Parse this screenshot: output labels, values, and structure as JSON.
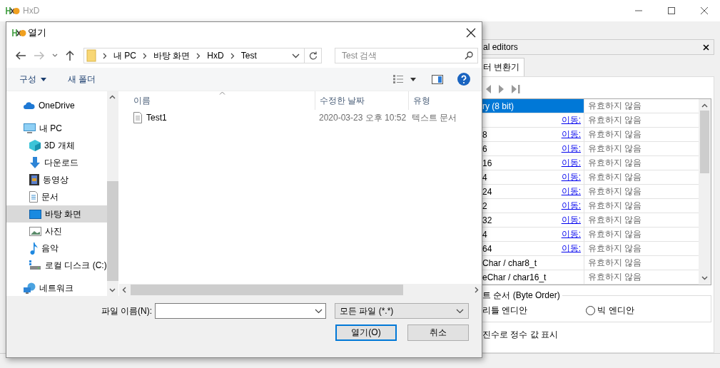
{
  "window": {
    "title": "HxD"
  },
  "dialog": {
    "title": "열기",
    "path": [
      "내 PC",
      "바탕 화면",
      "HxD",
      "Test"
    ],
    "search": {
      "placeholder": "Test 검색"
    },
    "commands": [
      {
        "label": "구성",
        "menu": true
      },
      {
        "label": "새 폴더",
        "menu": false
      }
    ],
    "nav": [
      {
        "label": "OneDrive",
        "kind": "cloud",
        "selected": false
      },
      {
        "label": "내 PC",
        "kind": "computer",
        "selected": false,
        "children": [
          {
            "label": "3D 개체",
            "kind": "cube",
            "selected": false
          },
          {
            "label": "다운로드",
            "kind": "download",
            "selected": false
          },
          {
            "label": "동영상",
            "kind": "film",
            "selected": false
          },
          {
            "label": "문서",
            "kind": "document",
            "selected": false
          },
          {
            "label": "바탕 화면",
            "kind": "desktop",
            "selected": true
          },
          {
            "label": "사진",
            "kind": "photo",
            "selected": false
          },
          {
            "label": "음악",
            "kind": "music",
            "selected": false
          },
          {
            "label": "로컬 디스크 (C:)",
            "kind": "drive",
            "selected": false
          }
        ]
      },
      {
        "label": "네트워크",
        "kind": "network",
        "selected": false
      }
    ],
    "columns": [
      "이름",
      "수정한 날짜",
      "유형"
    ],
    "files": [
      {
        "name": "Test1",
        "modified": "2020-03-23 오후 10:52",
        "type": "텍스트 문서",
        "selected": false
      }
    ],
    "filename_label": "파일 이름(N):",
    "filter": "모든 파일 (*.*)",
    "buttons": [
      {
        "label": "열기(O)",
        "default": true
      },
      {
        "label": "취소",
        "default": false
      }
    ]
  },
  "panel": {
    "title": "al editors",
    "tab": "터 변환기",
    "rows": [
      {
        "name": "ry (8 bit)",
        "value": "유효하지 않음",
        "selected": true
      },
      {
        "name": "",
        "link": "이동:",
        "value": "유효하지 않음",
        "selected": false
      },
      {
        "name": "8",
        "link": "이동:",
        "value": "유효하지 않음",
        "selected": false
      },
      {
        "name": "6",
        "link": "이동:",
        "value": "유효하지 않음",
        "selected": false
      },
      {
        "name": "16",
        "link": "이동:",
        "value": "유효하지 않음",
        "selected": false
      },
      {
        "name": "4",
        "link": "이동:",
        "value": "유효하지 않음",
        "selected": false
      },
      {
        "name": "24",
        "link": "이동:",
        "value": "유효하지 않음",
        "selected": false
      },
      {
        "name": "2",
        "link": "이동:",
        "value": "유효하지 않음",
        "selected": false
      },
      {
        "name": "32",
        "link": "이동:",
        "value": "유효하지 않음",
        "selected": false
      },
      {
        "name": "4",
        "link": "이동:",
        "value": "유효하지 않음",
        "selected": false
      },
      {
        "name": "64",
        "link": "이동:",
        "value": "유효하지 않음",
        "selected": false
      },
      {
        "name": "Char / char8_t",
        "value": "유효하지 않음",
        "selected": false
      },
      {
        "name": "eChar / char16_t",
        "value": "유효하지 않음",
        "selected": false
      }
    ],
    "byte_order": {
      "legend": "트 순서 (Byte Order)",
      "options": [
        {
          "label": "리틀 엔디안"
        },
        {
          "label": "빅 엔디안",
          "selected": false
        }
      ]
    },
    "option_label": "진수로 정수 값 표시"
  }
}
